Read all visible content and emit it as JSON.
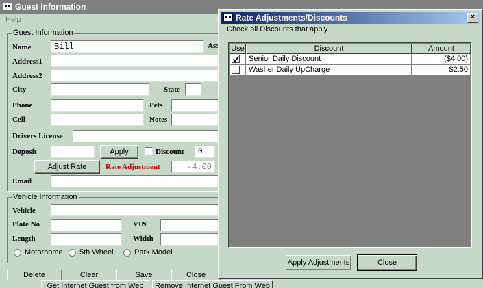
{
  "main": {
    "title": "Guest Information",
    "menu_help": "Help",
    "guest_group": {
      "label": "Guest Information",
      "name_label": "Name",
      "name_value": "Bill",
      "as_label": "As:",
      "address1_label": "Address1",
      "address2_label": "Address2",
      "city_label": "City",
      "state_label": "State",
      "phone_label": "Phone",
      "pets_label": "Pets",
      "cell_label": "Cell",
      "notes_label": "Notes",
      "drivers_license_label": "Drivers License",
      "deposit_label": "Deposit",
      "apply_button": "Apply",
      "discount_label": "Discount",
      "discount_value": "0",
      "adjust_rate_button": "Adjust Rate",
      "rate_adjustment_label": "Rate Adjustment",
      "rate_adjustment_value": "-4.00",
      "email_label": "Email"
    },
    "vehicle_group": {
      "label": "Vehicle Information",
      "vehicle_label": "Vehicle",
      "plate_label": "Plate No",
      "vin_label": "VIN",
      "length_label": "Length",
      "width_label": "Width",
      "radio_motorhome": "Motorhome",
      "radio_5thwheel": "5th Wheel",
      "radio_parkmodel": "Park Model"
    },
    "bottom_buttons": {
      "delete": "Delete",
      "clear": "Clear",
      "save": "Save",
      "close": "Close"
    },
    "web_buttons": {
      "get": "Get Internet Guest from Web",
      "remove": "Remove Internet Guest From Web"
    }
  },
  "dialog": {
    "title": "Rate Adjustments/Discounts",
    "close_glyph": "×",
    "instruction": "Check all Discounts that apply",
    "columns": {
      "use": "Use",
      "discount": "Discount",
      "amount": "Amount"
    },
    "rows": [
      {
        "checked": true,
        "discount": "Senior Daily Discount",
        "amount": "($4.00)"
      },
      {
        "checked": false,
        "discount": "Washer Daily UpCharge",
        "amount": "$2.50"
      }
    ],
    "apply_button": "Apply Adjustments",
    "close_button": "Close"
  }
}
